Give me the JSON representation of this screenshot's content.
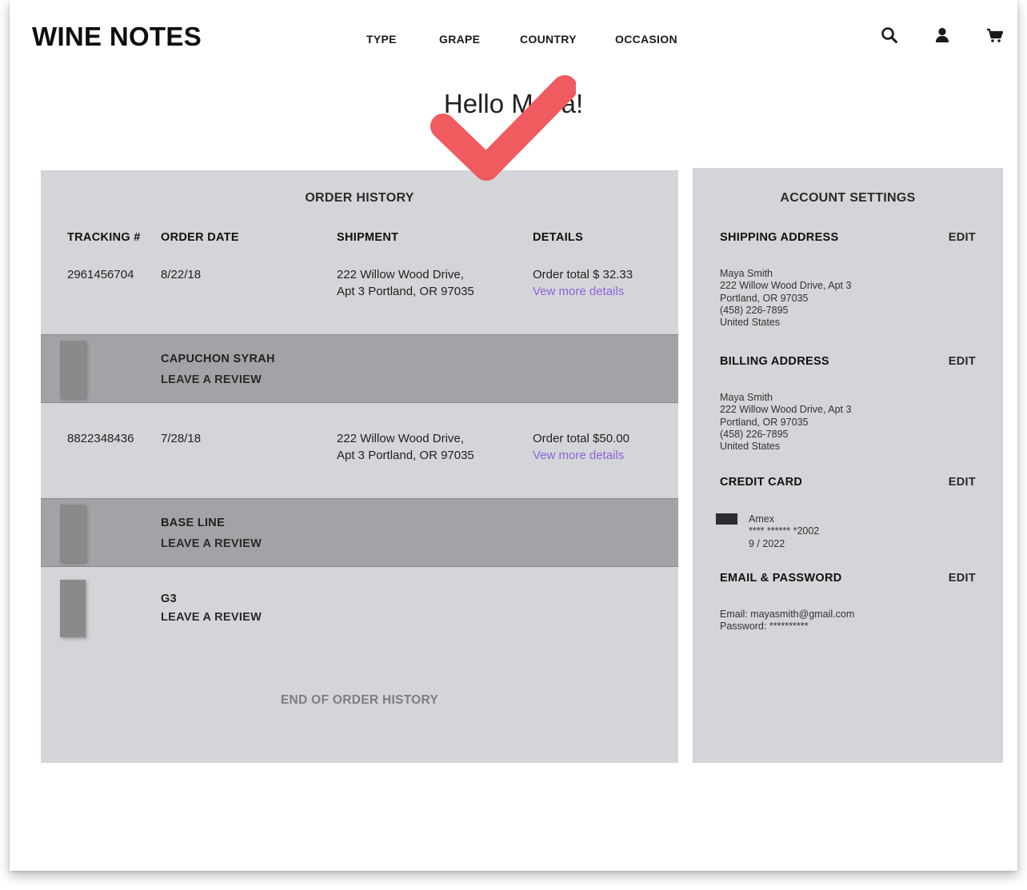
{
  "header": {
    "logo": "WINE NOTES",
    "nav": [
      "TYPE",
      "GRAPE",
      "COUNTRY",
      "OCCASION"
    ],
    "icons": [
      "search-icon",
      "user-icon",
      "cart-icon"
    ]
  },
  "greeting": "Hello Maya!",
  "orders": {
    "title": "ORDER HISTORY",
    "columns": [
      "TRACKING #",
      "ORDER DATE",
      "SHIPMENT",
      "DETAILS"
    ],
    "list": [
      {
        "tracking": "2961456704",
        "date": "8/22/18",
        "address_line1": "222 Willow Wood Drive,",
        "address_line2": "Apt 3 Portland, OR 97035",
        "total": "Order total $ 32.33",
        "details_link": "Vew more details"
      },
      {
        "tracking": "8822348436",
        "date": "7/28/18",
        "address_line1": "222 Willow Wood Drive,",
        "address_line2": "Apt 3 Portland, OR 97035",
        "total": "Order total $50.00",
        "details_link": "Vew more details"
      }
    ],
    "items": [
      {
        "name": "CAPUCHON SYRAH",
        "review": "LEAVE A REVIEW"
      },
      {
        "name": "BASE LINE",
        "review": "LEAVE A REVIEW"
      },
      {
        "name": "G3",
        "review": "LEAVE A REVIEW"
      }
    ],
    "end_note": "END OF ORDER HISTORY"
  },
  "account": {
    "title": "ACCOUNT SETTINGS",
    "edit_label": "EDIT",
    "shipping": {
      "heading": "SHIPPING ADDRESS",
      "lines": [
        "Maya Smith",
        "222 Willow Wood Drive, Apt 3",
        "Portland, OR 97035",
        "(458) 226-7895",
        "United States"
      ]
    },
    "billing": {
      "heading": "BILLING ADDRESS",
      "lines": [
        "Maya Smith",
        "222 Willow Wood Drive, Apt 3",
        "Portland, OR 97035",
        "(458) 226-7895",
        "United States"
      ]
    },
    "credit_card": {
      "heading": "CREDIT CARD",
      "brand": "Amex",
      "number": "**** ****** *2002",
      "expiry": "9 / 2022"
    },
    "email_password": {
      "heading": "EMAIL & PASSWORD",
      "email": "Email: mayasmith@gmail.com",
      "password": "Password: **********"
    }
  },
  "colors": {
    "panel": "#d4d5d8",
    "item_band": "#a2a3a6",
    "link": "#8c63d9",
    "check": "#ef5b5f"
  }
}
